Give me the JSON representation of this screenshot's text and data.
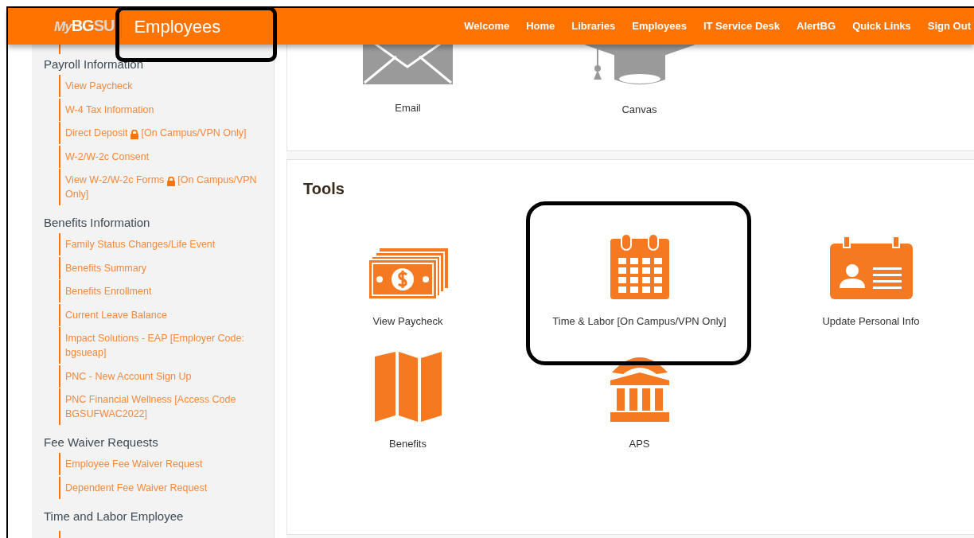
{
  "header": {
    "logo_parts": [
      "My",
      "BG",
      "SU"
    ],
    "title": {
      "text": "Employees",
      "highlighted": true
    },
    "nav_links": [
      "Welcome",
      "Home",
      "Libraries",
      "Employees",
      "IT Service Desk",
      "AlertBG",
      "Quick Links",
      "Sign Out"
    ]
  },
  "sidebar": {
    "sections": [
      {
        "heading": "Payroll Information",
        "links": [
          {
            "text": "View Paycheck",
            "locked": false
          },
          {
            "text": "W-4 Tax Information",
            "locked": false
          },
          {
            "text": "Direct Deposit",
            "locked": true,
            "note": "[On Campus/VPN Only]"
          },
          {
            "text": "W-2/W-2c Consent",
            "locked": false
          },
          {
            "text": "View W-2/W-2c Forms",
            "locked": true,
            "note": "[On Campus/VPN Only]"
          }
        ]
      },
      {
        "heading": "Benefits Information",
        "links": [
          {
            "text": "Family Status Changes/Life Event",
            "locked": false
          },
          {
            "text": "Benefits Summary",
            "locked": false
          },
          {
            "text": "Benefits Enrollment",
            "locked": false
          },
          {
            "text": "Current Leave Balance",
            "locked": false
          },
          {
            "text": "Impact Solutions - EAP [Employer Code: bgsueap]",
            "locked": false
          },
          {
            "text": "PNC - New Account Sign Up",
            "locked": false
          },
          {
            "text": "PNC Financial Wellness [Access Code BGSUFWAC2022]",
            "locked": false
          }
        ]
      },
      {
        "heading": "Fee Waiver Requests",
        "links": [
          {
            "text": "Employee Fee Waiver Request",
            "locked": false
          },
          {
            "text": "Dependent Fee Waiver Request",
            "locked": false
          }
        ]
      },
      {
        "heading": "Time and Labor Employee"
      }
    ]
  },
  "apps": [
    {
      "label": "Email",
      "kind": "envelope"
    },
    {
      "label": "Canvas",
      "kind": "cap"
    }
  ],
  "tools": {
    "title": "Tools",
    "items": [
      {
        "label": "View Paycheck",
        "kind": "money",
        "highlighted": false
      },
      {
        "label": "Time & Labor [On Campus/VPN Only]",
        "kind": "calendar",
        "highlighted": true
      },
      {
        "label": "Update Personal Info",
        "kind": "idcard",
        "highlighted": false
      },
      {
        "label": "Benefits",
        "kind": "map",
        "highlighted": false
      },
      {
        "label": "APS",
        "kind": "bank",
        "highlighted": false
      }
    ]
  }
}
